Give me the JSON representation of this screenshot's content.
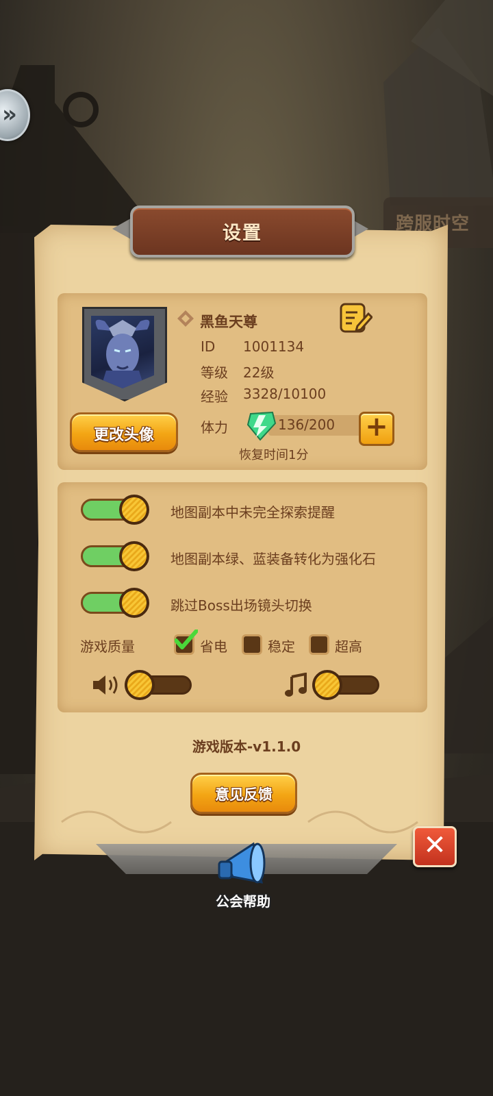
{
  "background": {
    "side_tab_label": "跨服时空"
  },
  "dialog": {
    "title": "设置",
    "profile": {
      "name": "黑鱼天尊",
      "id_label": "ID",
      "id_value": "1001134",
      "level_label": "等级",
      "level_value": "22级",
      "exp_label": "经验",
      "exp_value": "3328/10100",
      "stamina_label": "体力",
      "stamina_value": "136/200",
      "recovery_text": "恢复时间1分",
      "change_avatar_label": "更改头像"
    },
    "settings": {
      "toggles": [
        {
          "label": "地图副本中未完全探索提醒",
          "on": true
        },
        {
          "label": "地图副本绿、蓝装备转化为强化石",
          "on": true
        },
        {
          "label": "跳过Boss出场镜头切换",
          "on": true
        }
      ],
      "quality_label": "游戏质量",
      "quality_options": [
        {
          "label": "省电",
          "checked": true
        },
        {
          "label": "稳定",
          "checked": false
        },
        {
          "label": "超高",
          "checked": false
        }
      ],
      "sound_volume": 0,
      "music_volume": 0
    },
    "version_text": "游戏版本-v1.1.0",
    "feedback_label": "意见反馈"
  },
  "guild_help_label": "公会帮助",
  "colors": {
    "panel": "#ecd3a0",
    "section": "#e1bd82",
    "text_brown": "#6b3e1f",
    "toggle_on": "#6fcf63",
    "accent_orange": "#f3a514",
    "close_red": "#d9442a"
  }
}
